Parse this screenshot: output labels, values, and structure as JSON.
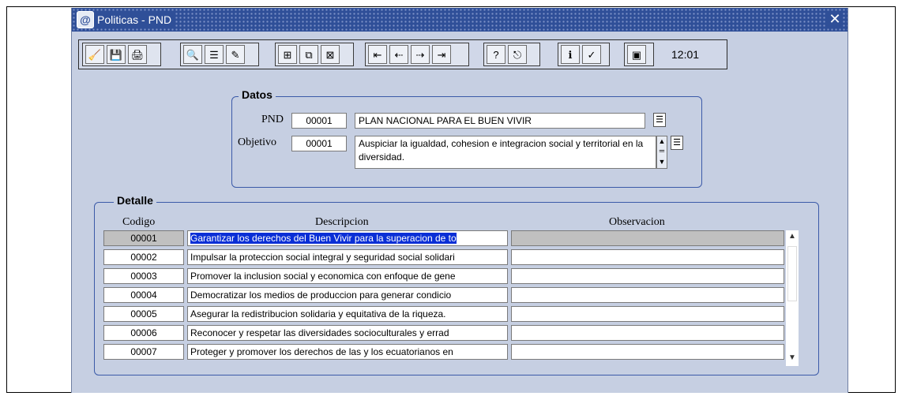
{
  "window": {
    "title": "Politicas - PND",
    "close_glyph": "✕",
    "icon_letter": "@"
  },
  "toolbar": {
    "buttons": [
      {
        "name": "clear-icon",
        "glyph": "🧹"
      },
      {
        "name": "save-icon",
        "glyph": "💾"
      },
      {
        "name": "print-icon",
        "glyph": "🖨"
      },
      {
        "name": "query-icon",
        "glyph": "🔍"
      },
      {
        "name": "list-icon",
        "glyph": "☰"
      },
      {
        "name": "edit-icon",
        "glyph": "✎"
      },
      {
        "name": "insert-record-icon",
        "glyph": "⊞"
      },
      {
        "name": "duplicate-record-icon",
        "glyph": "⧉"
      },
      {
        "name": "delete-record-icon",
        "glyph": "⊠"
      },
      {
        "name": "first-record-icon",
        "glyph": "⇤"
      },
      {
        "name": "previous-record-icon",
        "glyph": "⇠"
      },
      {
        "name": "next-record-icon",
        "glyph": "⇢"
      },
      {
        "name": "last-record-icon",
        "glyph": "⇥"
      },
      {
        "name": "help-icon",
        "glyph": "?"
      },
      {
        "name": "exit-icon",
        "glyph": "⎋"
      },
      {
        "name": "info-icon",
        "glyph": "ℹ"
      },
      {
        "name": "check-icon",
        "glyph": "✓"
      },
      {
        "name": "calendar-icon",
        "glyph": "▣"
      }
    ],
    "clock": "12:01"
  },
  "datos": {
    "title": "Datos",
    "pnd_label": "PND",
    "pnd_code": "00001",
    "pnd_name": "PLAN NACIONAL PARA EL  BUEN VIVIR",
    "objetivo_label": "Objetivo",
    "objetivo_code": "00001",
    "objetivo_text": "Auspiciar la igualdad, cohesion e integracion social y territorial en la diversidad."
  },
  "detalle": {
    "title": "Detalle",
    "headers": {
      "codigo": "Codigo",
      "descripcion": "Descripcion",
      "observacion": "Observacion"
    },
    "rows": [
      {
        "codigo": "00001",
        "descripcion": "Garantizar los derechos del Buen Vivir para la superacion de to",
        "observacion": ""
      },
      {
        "codigo": "00002",
        "descripcion": "Impulsar la proteccion social integral y seguridad social solidari",
        "observacion": ""
      },
      {
        "codigo": "00003",
        "descripcion": "Promover la inclusion social y economica con enfoque de gene",
        "observacion": ""
      },
      {
        "codigo": "00004",
        "descripcion": "Democratizar los medios  de produccion para generar condicio",
        "observacion": ""
      },
      {
        "codigo": "00005",
        "descripcion": "Asegurar la redistribucion solidaria y equitativa de la riqueza.",
        "observacion": ""
      },
      {
        "codigo": "00006",
        "descripcion": "Reconocer y respetar las diversidades socioculturales y errad",
        "observacion": ""
      },
      {
        "codigo": "00007",
        "descripcion": "Proteger y promover los derechos de las y los ecuatorianos en",
        "observacion": ""
      }
    ],
    "selected_row": 0
  },
  "colors": {
    "accent": "#2f4f98",
    "panel": "#c6cfe2",
    "selection": "#0a2fd6"
  }
}
